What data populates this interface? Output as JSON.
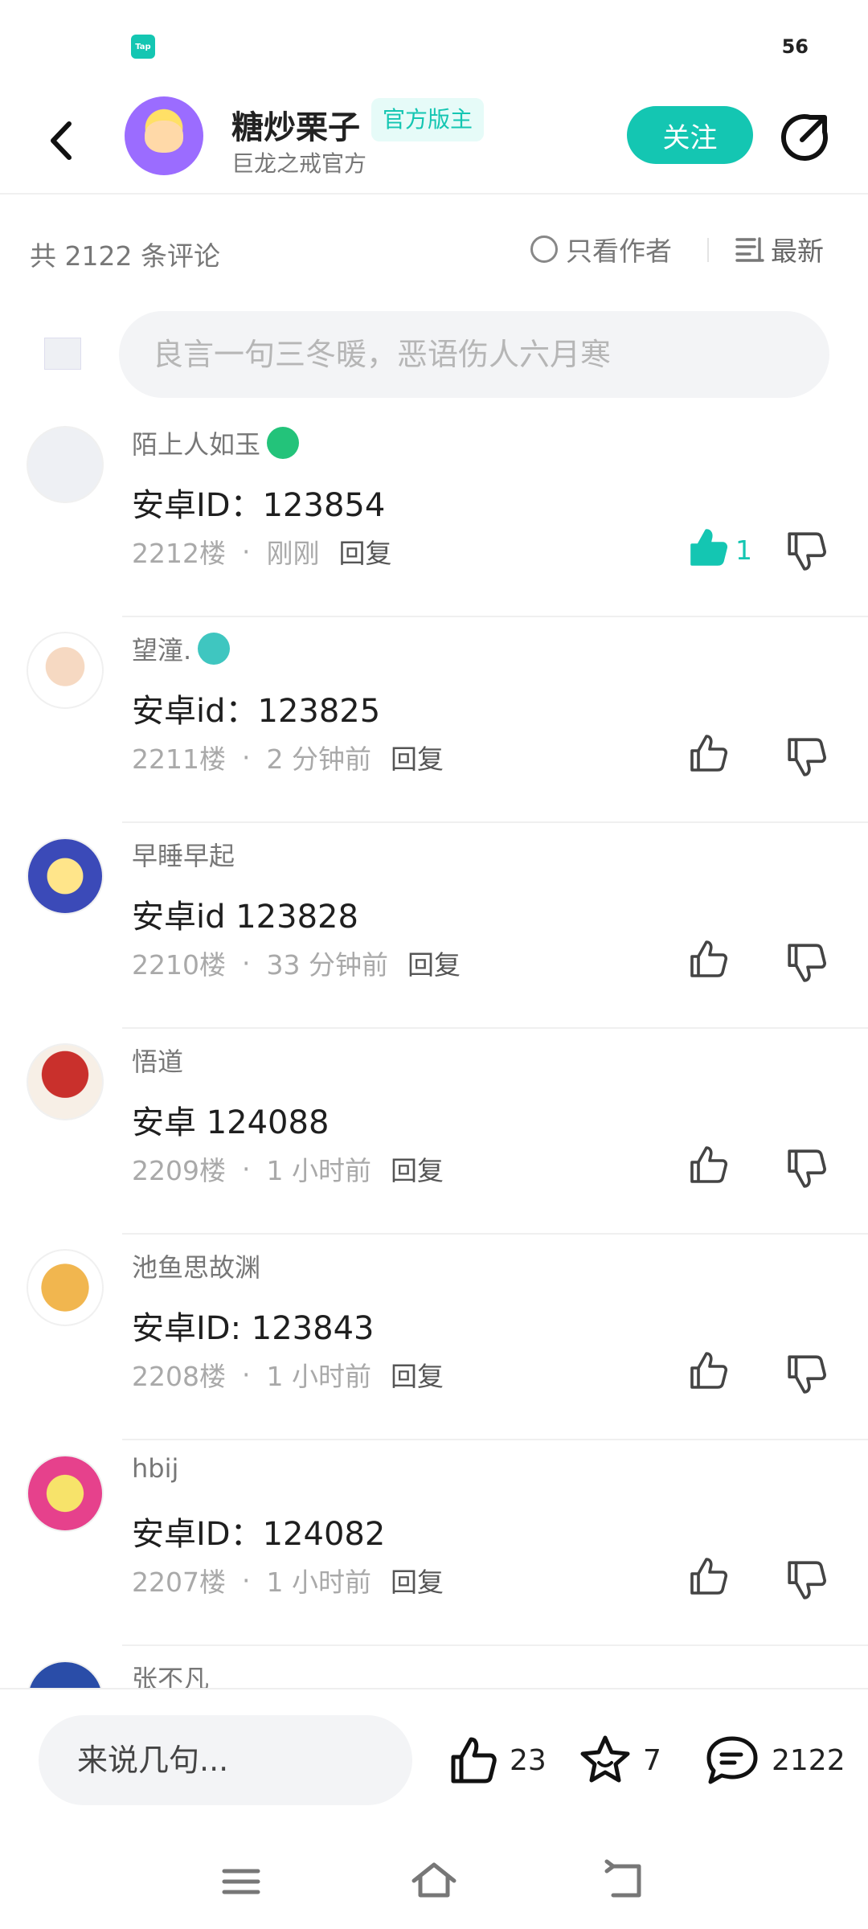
{
  "status_bar": {
    "app_badge": "Tap",
    "battery": "56"
  },
  "header": {
    "author_name": "糖炒栗子",
    "author_badge": "官方版主",
    "author_subtitle": "巨龙之戒官方",
    "follow_label": "关注"
  },
  "filter": {
    "count_label": "共 2122 条评论",
    "only_author_label": "只看作者",
    "sort_label": "最新"
  },
  "composer": {
    "placeholder": "良言一句三冬暖，恶语伤人六月寒"
  },
  "comments": [
    {
      "name": "陌上人如玉",
      "badge": "game-controller-badge",
      "text": "安卓ID：123854",
      "floor": "2212楼",
      "time": "刚刚",
      "reply": "回复",
      "likes": "1",
      "liked": true
    },
    {
      "name": "望潼.",
      "badge": "teal-emblem-badge",
      "text": "安卓id：123825",
      "floor": "2211楼",
      "time": "2 分钟前",
      "reply": "回复",
      "likes": "",
      "liked": false
    },
    {
      "name": "早睡早起",
      "badge": "",
      "text": "安卓id 123828",
      "floor": "2210楼",
      "time": "33 分钟前",
      "reply": "回复",
      "likes": "",
      "liked": false
    },
    {
      "name": "悟道",
      "badge": "",
      "text": "安卓 124088",
      "floor": "2209楼",
      "time": "1 小时前",
      "reply": "回复",
      "likes": "",
      "liked": false
    },
    {
      "name": "池鱼思故渊",
      "badge": "",
      "text": "安卓ID: 123843",
      "floor": "2208楼",
      "time": "1 小时前",
      "reply": "回复",
      "likes": "",
      "liked": false
    },
    {
      "name": "hbij",
      "badge": "",
      "text": "安卓ID：124082",
      "floor": "2207楼",
      "time": "1 小时前",
      "reply": "回复",
      "likes": "",
      "liked": false
    },
    {
      "name": "张不凡",
      "badge": "",
      "text": "",
      "floor": "",
      "time": "",
      "reply": "",
      "likes": "",
      "liked": false
    }
  ],
  "bottom_bar": {
    "say_label": "来说几句...",
    "like_count": "23",
    "favorite_count": "7",
    "comment_count": "2122"
  },
  "colors": {
    "accent": "#14c6b2",
    "text": "#1f1f1f",
    "muted": "#a9a9a9"
  }
}
